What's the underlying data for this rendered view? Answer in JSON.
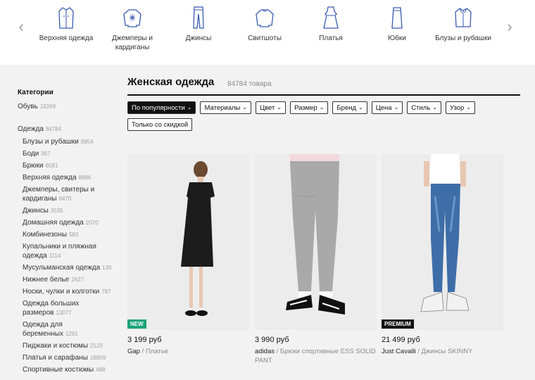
{
  "categories": [
    {
      "label": "Верхняя одежда",
      "icon": "coat-icon"
    },
    {
      "label": "Джемперы и кардиганы",
      "icon": "sweater-icon"
    },
    {
      "label": "Джинсы",
      "icon": "jeans-icon"
    },
    {
      "label": "Свитшоты",
      "icon": "sweatshirt-icon"
    },
    {
      "label": "Платья",
      "icon": "dress-icon"
    },
    {
      "label": "Юбки",
      "icon": "skirt-icon"
    },
    {
      "label": "Блузы и рубашки",
      "icon": "shirt-icon"
    }
  ],
  "nav": {
    "prev_icon": "chevron-left-icon",
    "next_icon": "chevron-right-icon"
  },
  "sidebar": {
    "heading": "Категории",
    "shoes": {
      "label": "Обувь",
      "count": "19269"
    },
    "clothing": {
      "label": "Одежда",
      "count": "84784"
    },
    "items": [
      {
        "label": "Блузы и рубашки",
        "count": "8954"
      },
      {
        "label": "Боди",
        "count": "367"
      },
      {
        "label": "Брюки",
        "count": "6581"
      },
      {
        "label": "Верхняя одежда",
        "count": "8986"
      },
      {
        "label": "Джемперы, свитеры и кардиганы",
        "count": "8470"
      },
      {
        "label": "Джинсы",
        "count": "3535"
      },
      {
        "label": "Домашняя одежда",
        "count": "2070"
      },
      {
        "label": "Комбинезоны",
        "count": "583"
      },
      {
        "label": "Купальники и пляжная одежда",
        "count": "1114"
      },
      {
        "label": "Мусульманская одежда",
        "count": "130"
      },
      {
        "label": "Нижнее белье",
        "count": "2627"
      },
      {
        "label": "Носки, чулки и колготки",
        "count": "797"
      },
      {
        "label": "Одежда больших размеров",
        "count": "13077"
      },
      {
        "label": "Одежда для беременных",
        "count": "1291"
      },
      {
        "label": "Пиджаки и костюмы",
        "count": "2123"
      },
      {
        "label": "Платья и сарафаны",
        "count": "18809"
      },
      {
        "label": "Спортивные костюмы",
        "count": "488"
      }
    ]
  },
  "main": {
    "title": "Женская одежда",
    "count": "84784 товара",
    "filters": [
      {
        "label": "По популярности",
        "active": true
      },
      {
        "label": "Материалы"
      },
      {
        "label": "Цвет"
      },
      {
        "label": "Размер"
      },
      {
        "label": "Бренд"
      },
      {
        "label": "Цена"
      },
      {
        "label": "Стиль"
      },
      {
        "label": "Узор"
      }
    ],
    "discount_filter": "Только со скидкой",
    "products": [
      {
        "price": "3 199 руб",
        "brand": "Gap",
        "name": "Платье",
        "badge": "NEW",
        "badge_color": "#1aa37a"
      },
      {
        "price": "3 990 руб",
        "brand": "adidas",
        "name": "Брюки спортивные ESS SOLID PANT",
        "badge": ""
      },
      {
        "price": "21 499 руб",
        "brand": "Just Cavalli",
        "name": "Джинсы SKINNY",
        "badge": "PREMIUM",
        "badge_color": "#111111"
      }
    ]
  },
  "colors": {
    "accent": "#111111",
    "icon": "#3a5bb0",
    "new_badge": "#1aa37a"
  }
}
